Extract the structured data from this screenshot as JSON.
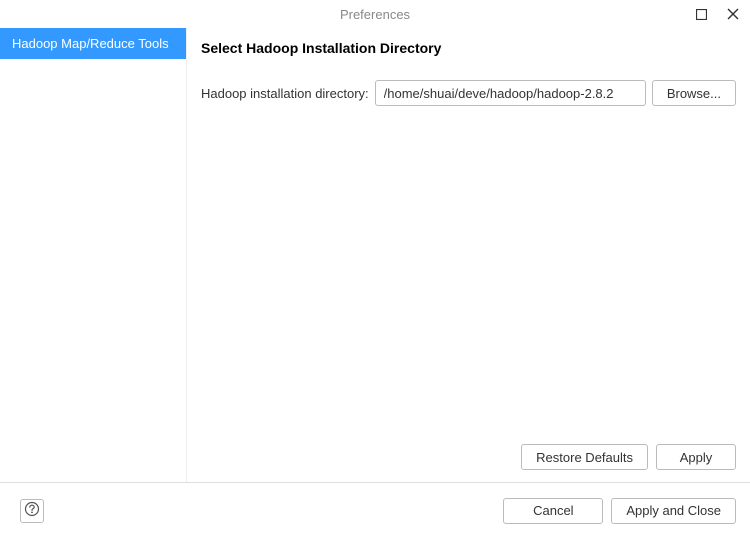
{
  "window": {
    "title": "Preferences"
  },
  "sidebar": {
    "items": [
      {
        "label": "Hadoop Map/Reduce Tools",
        "selected": true
      }
    ]
  },
  "page": {
    "heading": "Select Hadoop Installation Directory",
    "dir_label": "Hadoop installation directory:",
    "dir_value": "/home/shuai/deve/hadoop/hadoop-2.8.2",
    "browse_label": "Browse..."
  },
  "buttons": {
    "restore_defaults": "Restore Defaults",
    "apply": "Apply",
    "cancel": "Cancel",
    "apply_and_close": "Apply and Close"
  }
}
